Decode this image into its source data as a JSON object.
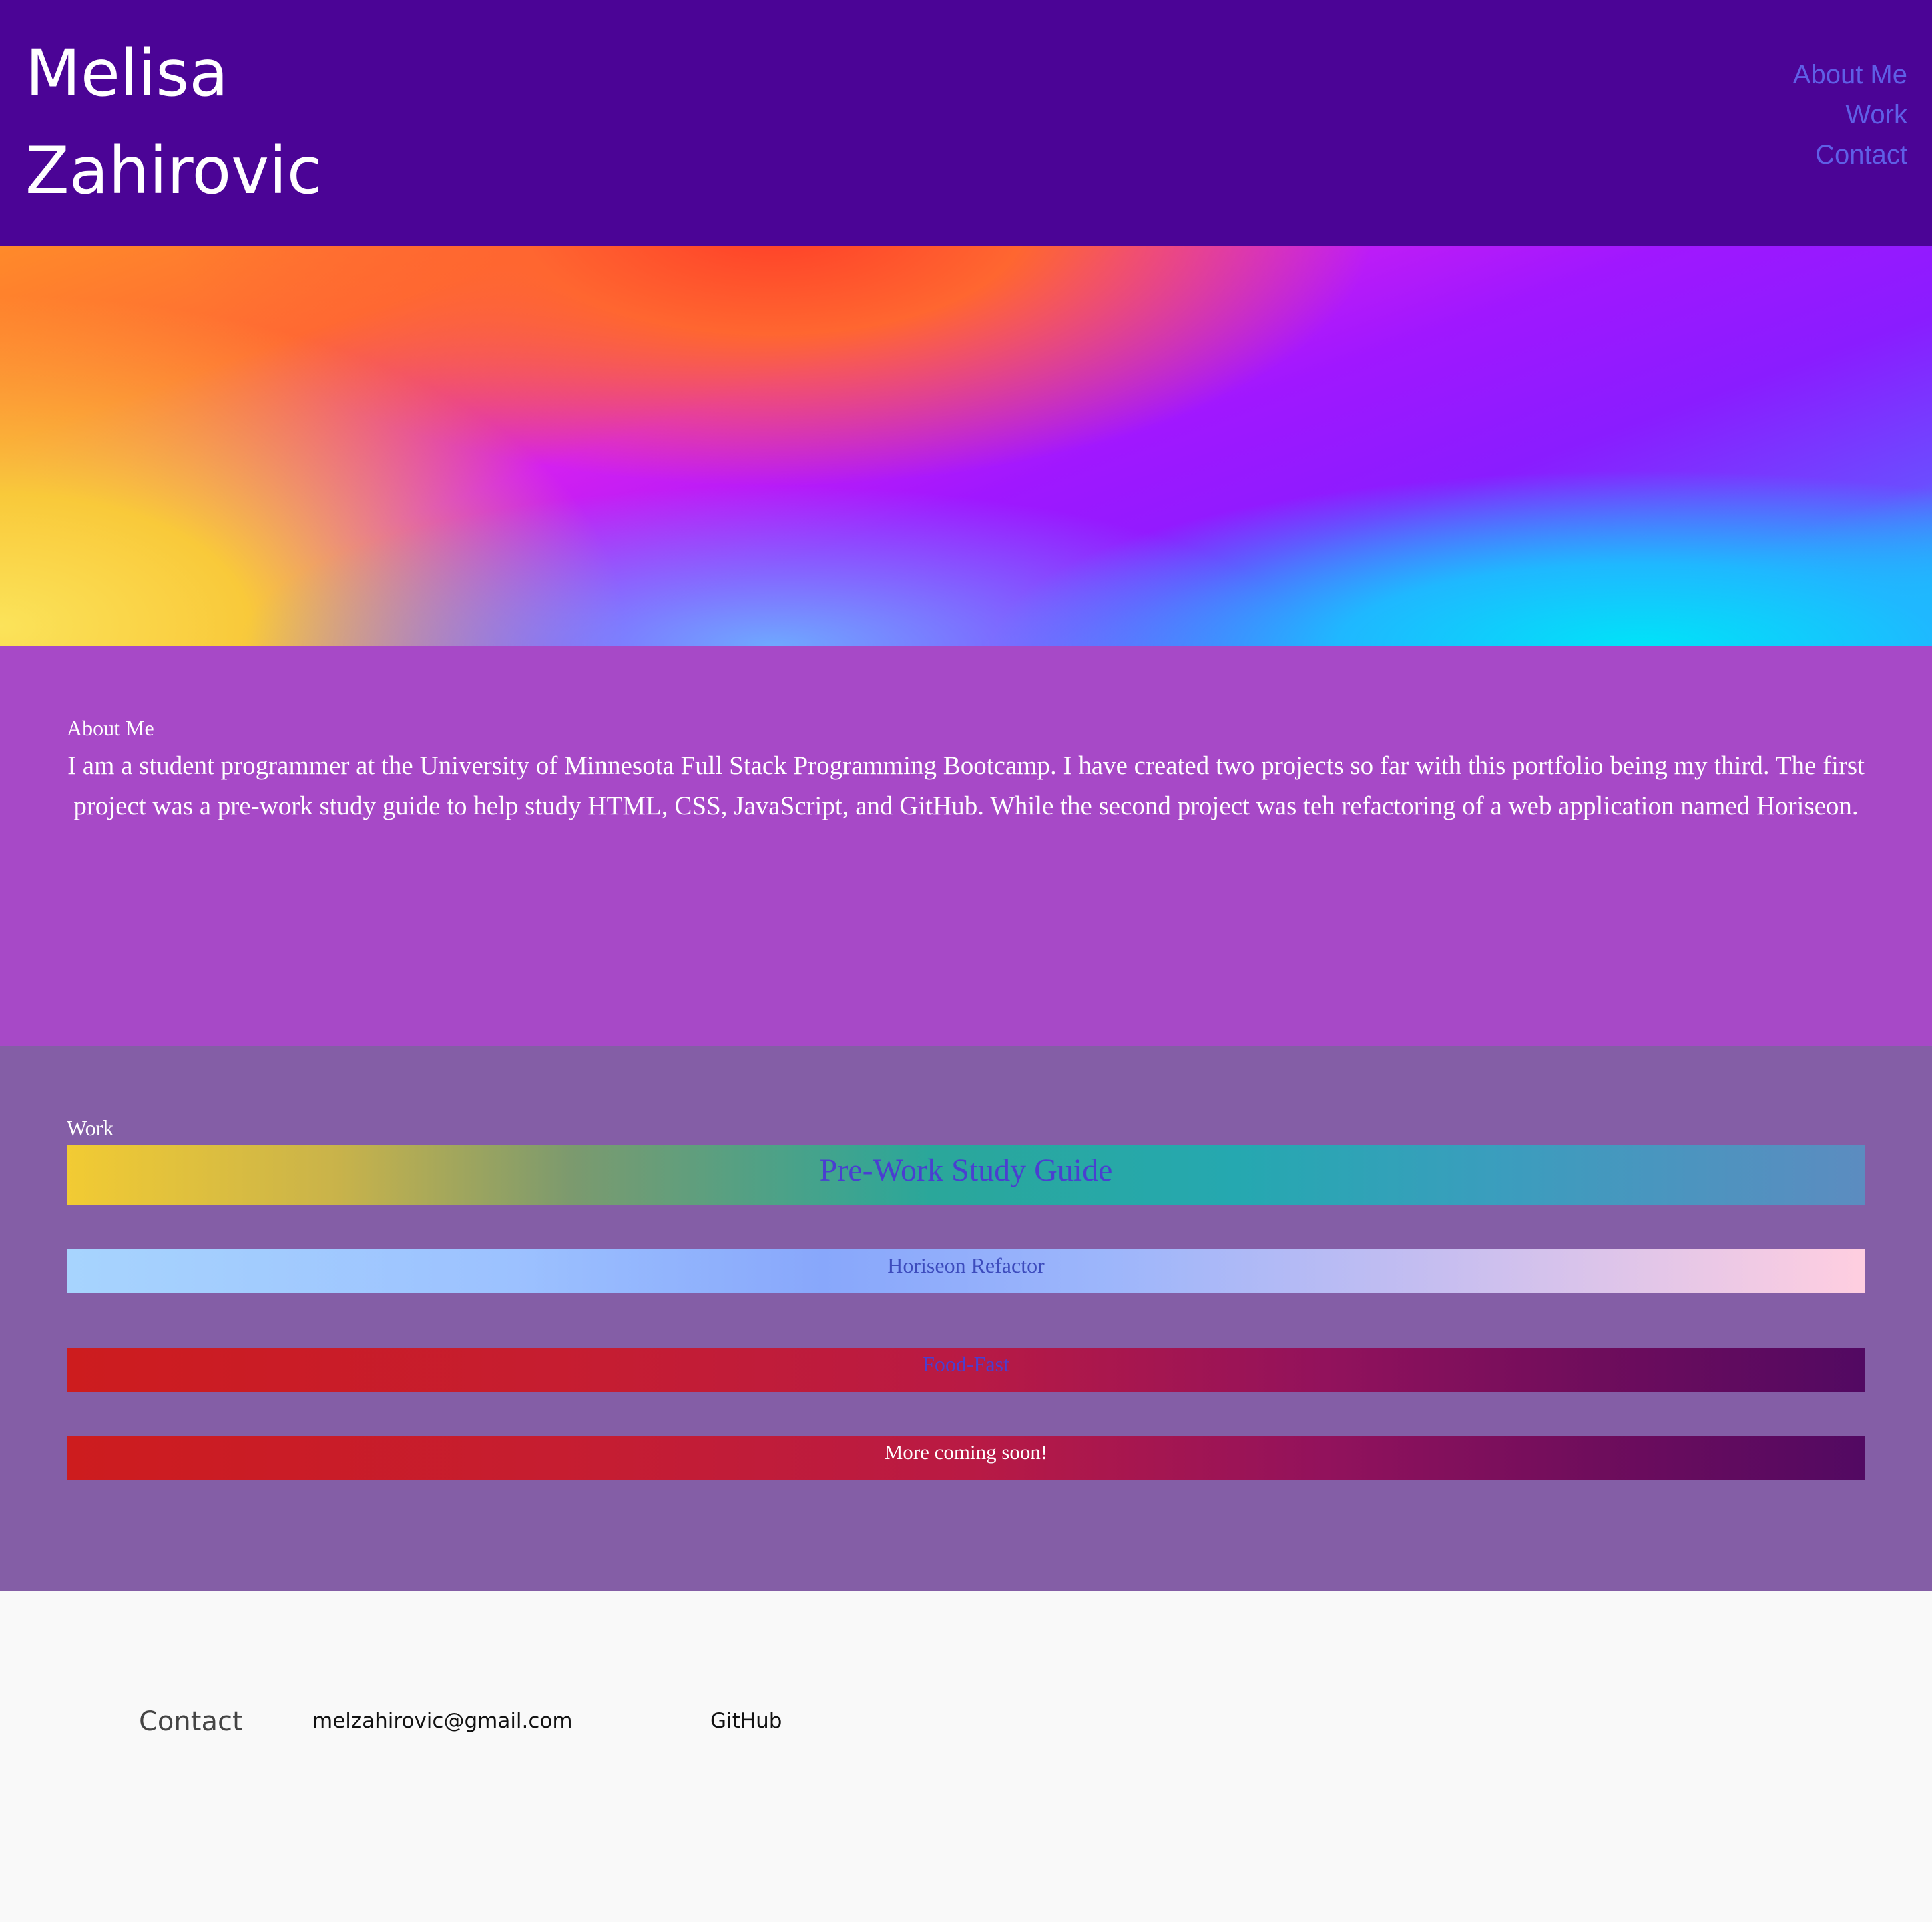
{
  "header": {
    "name_first": "Melisa",
    "name_last": "Zahirovic",
    "background_color": "#4b0496"
  },
  "nav": {
    "items": [
      {
        "label": "About Me"
      },
      {
        "label": "Work"
      },
      {
        "label": "Contact"
      }
    ],
    "link_color": "#5f5fe6"
  },
  "hero": {
    "description": "colorful gradient banner image"
  },
  "about": {
    "title": "About Me",
    "text": "I am a student programmer at the University of Minnesota Full Stack Programming Bootcamp. I have created two projects so far with this portfolio being my third. The first project was a pre-work study guide to help study HTML, CSS, JavaScript, and GitHub. While the second project was teh refactoring of a web application named Horiseon.",
    "background_color": "#a749c7"
  },
  "work": {
    "title": "Work",
    "background_color": "#845ea6",
    "items": [
      {
        "label": "Pre-Work Study Guide"
      },
      {
        "label": "Horiseon Refactor"
      },
      {
        "label": "Food-Fast"
      },
      {
        "label": "More coming soon!"
      }
    ]
  },
  "contact": {
    "title": "Contact",
    "email": "melzahirovic@gmail.com",
    "github": "GitHub"
  }
}
